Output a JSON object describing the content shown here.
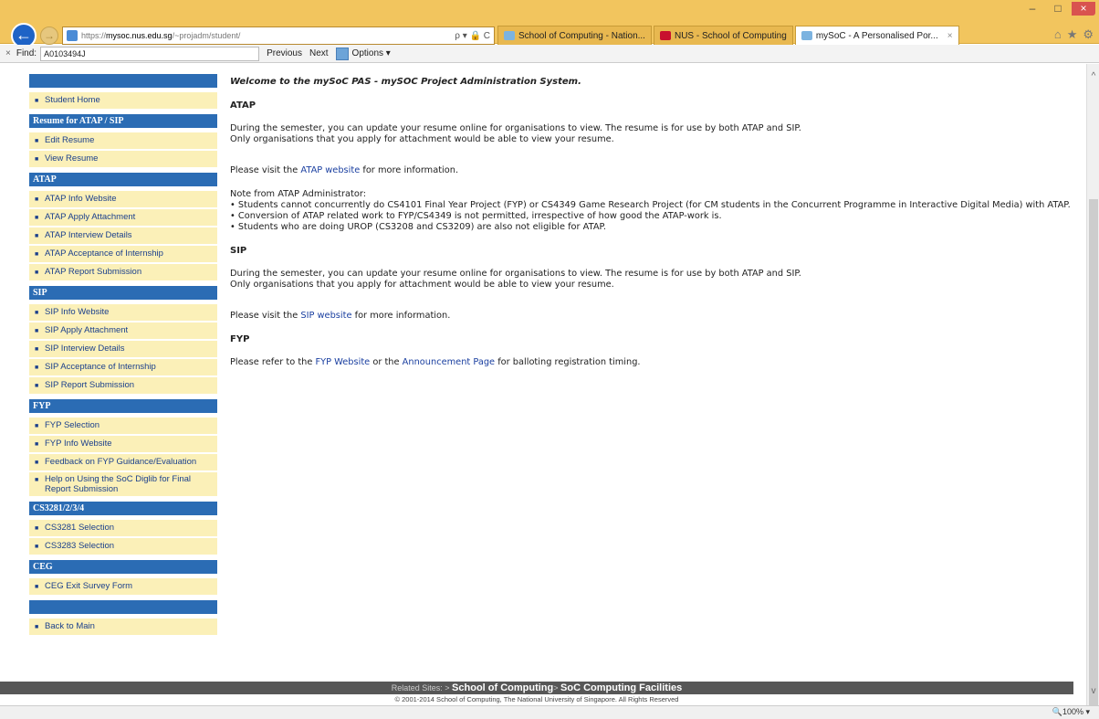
{
  "browser": {
    "url_prefix": "https://",
    "url_domain": "mysoc.nus.edu.sg",
    "url_path": "/~projadm/student/",
    "addr_tools": "ρ ▾ 🔒 C",
    "tabs": [
      {
        "label": "School of Computing - Nation...",
        "active": false
      },
      {
        "label": "NUS - School of Computing",
        "active": false
      },
      {
        "label": "mySoC - A Personalised Por...",
        "active": true
      }
    ],
    "tab_close": "×",
    "win_controls": {
      "minimize": "–",
      "maximize": "□",
      "close": "×"
    },
    "right_icons": {
      "home": "⌂",
      "star": "★",
      "gear": "⚙"
    }
  },
  "findbar": {
    "close": "×",
    "label": "Find:",
    "value": "A0103494J",
    "previous": "Previous",
    "next": "Next",
    "options": "Options ▾"
  },
  "sidebar": {
    "home_items": [
      "Student Home"
    ],
    "sections": [
      {
        "title": "Resume for ATAP / SIP",
        "items": [
          "Edit Resume",
          "View Resume"
        ]
      },
      {
        "title": "ATAP",
        "items": [
          "ATAP Info Website",
          "ATAP Apply Attachment",
          "ATAP Interview Details",
          "ATAP Acceptance of Internship",
          "ATAP Report Submission"
        ]
      },
      {
        "title": "SIP",
        "items": [
          "SIP Info Website",
          "SIP Apply Attachment",
          "SIP Interview Details",
          "SIP Acceptance of Internship",
          "SIP Report Submission"
        ]
      },
      {
        "title": "FYP",
        "items": [
          "FYP Selection",
          "FYP Info Website",
          "Feedback on FYP Guidance/Evaluation",
          "Help on Using the SoC Diglib for Final Report Submission"
        ]
      },
      {
        "title": "CS3281/2/3/4",
        "items": [
          "CS3281 Selection",
          "CS3283 Selection"
        ]
      },
      {
        "title": "CEG",
        "items": [
          "CEG Exit Survey Form"
        ]
      },
      {
        "title": "",
        "items": [
          "Back to Main"
        ]
      }
    ]
  },
  "content": {
    "welcome": "Welcome to the mySoC PAS - mySOC Project Administration System.",
    "atap": {
      "heading": "ATAP",
      "p1_line1": "During the semester, you can update your resume online for organisations to view. The resume is for use by both ATAP and SIP.",
      "p1_line2": "Only organisations that you apply for attachment would be able to view your resume.",
      "visit_pre": "Please visit the ",
      "visit_link": "ATAP website",
      "visit_post": " for more information.",
      "note_title": "Note from ATAP Administrator:",
      "note1": "• Students cannot concurrently do CS4101 Final Year Project (FYP) or CS4349 Game Research Project (for CM students in the Concurrent Programme in Interactive Digital Media) with ATAP.",
      "note2": "• Conversion of ATAP related work to FYP/CS4349 is not permitted, irrespective of how good the ATAP-work is.",
      "note3": "• Students who are doing UROP (CS3208 and CS3209) are also not eligible for ATAP."
    },
    "sip": {
      "heading": "SIP",
      "p1_line1": "During the semester, you can update your resume online for organisations to view. The resume is for use by both ATAP and SIP.",
      "p1_line2": "Only organisations that you apply for attachment would be able to view your resume.",
      "visit_pre": "Please visit the ",
      "visit_link": "SIP website",
      "visit_post": " for more information."
    },
    "fyp": {
      "heading": "FYP",
      "pre": "Please refer to the ",
      "link1": "FYP Website",
      "mid": " or the ",
      "link2": "Announcement Page",
      "post": " for balloting registration timing."
    }
  },
  "footer": {
    "related": "Related Sites: > ",
    "site1": "School of Computing",
    "sep": "> ",
    "site2": "SoC Computing Facilities",
    "copyright": "© 2001-2014 School of Computing, The National University of Singapore. All Rights Reserved"
  },
  "status": {
    "zoom": "🔍100% ▾"
  }
}
